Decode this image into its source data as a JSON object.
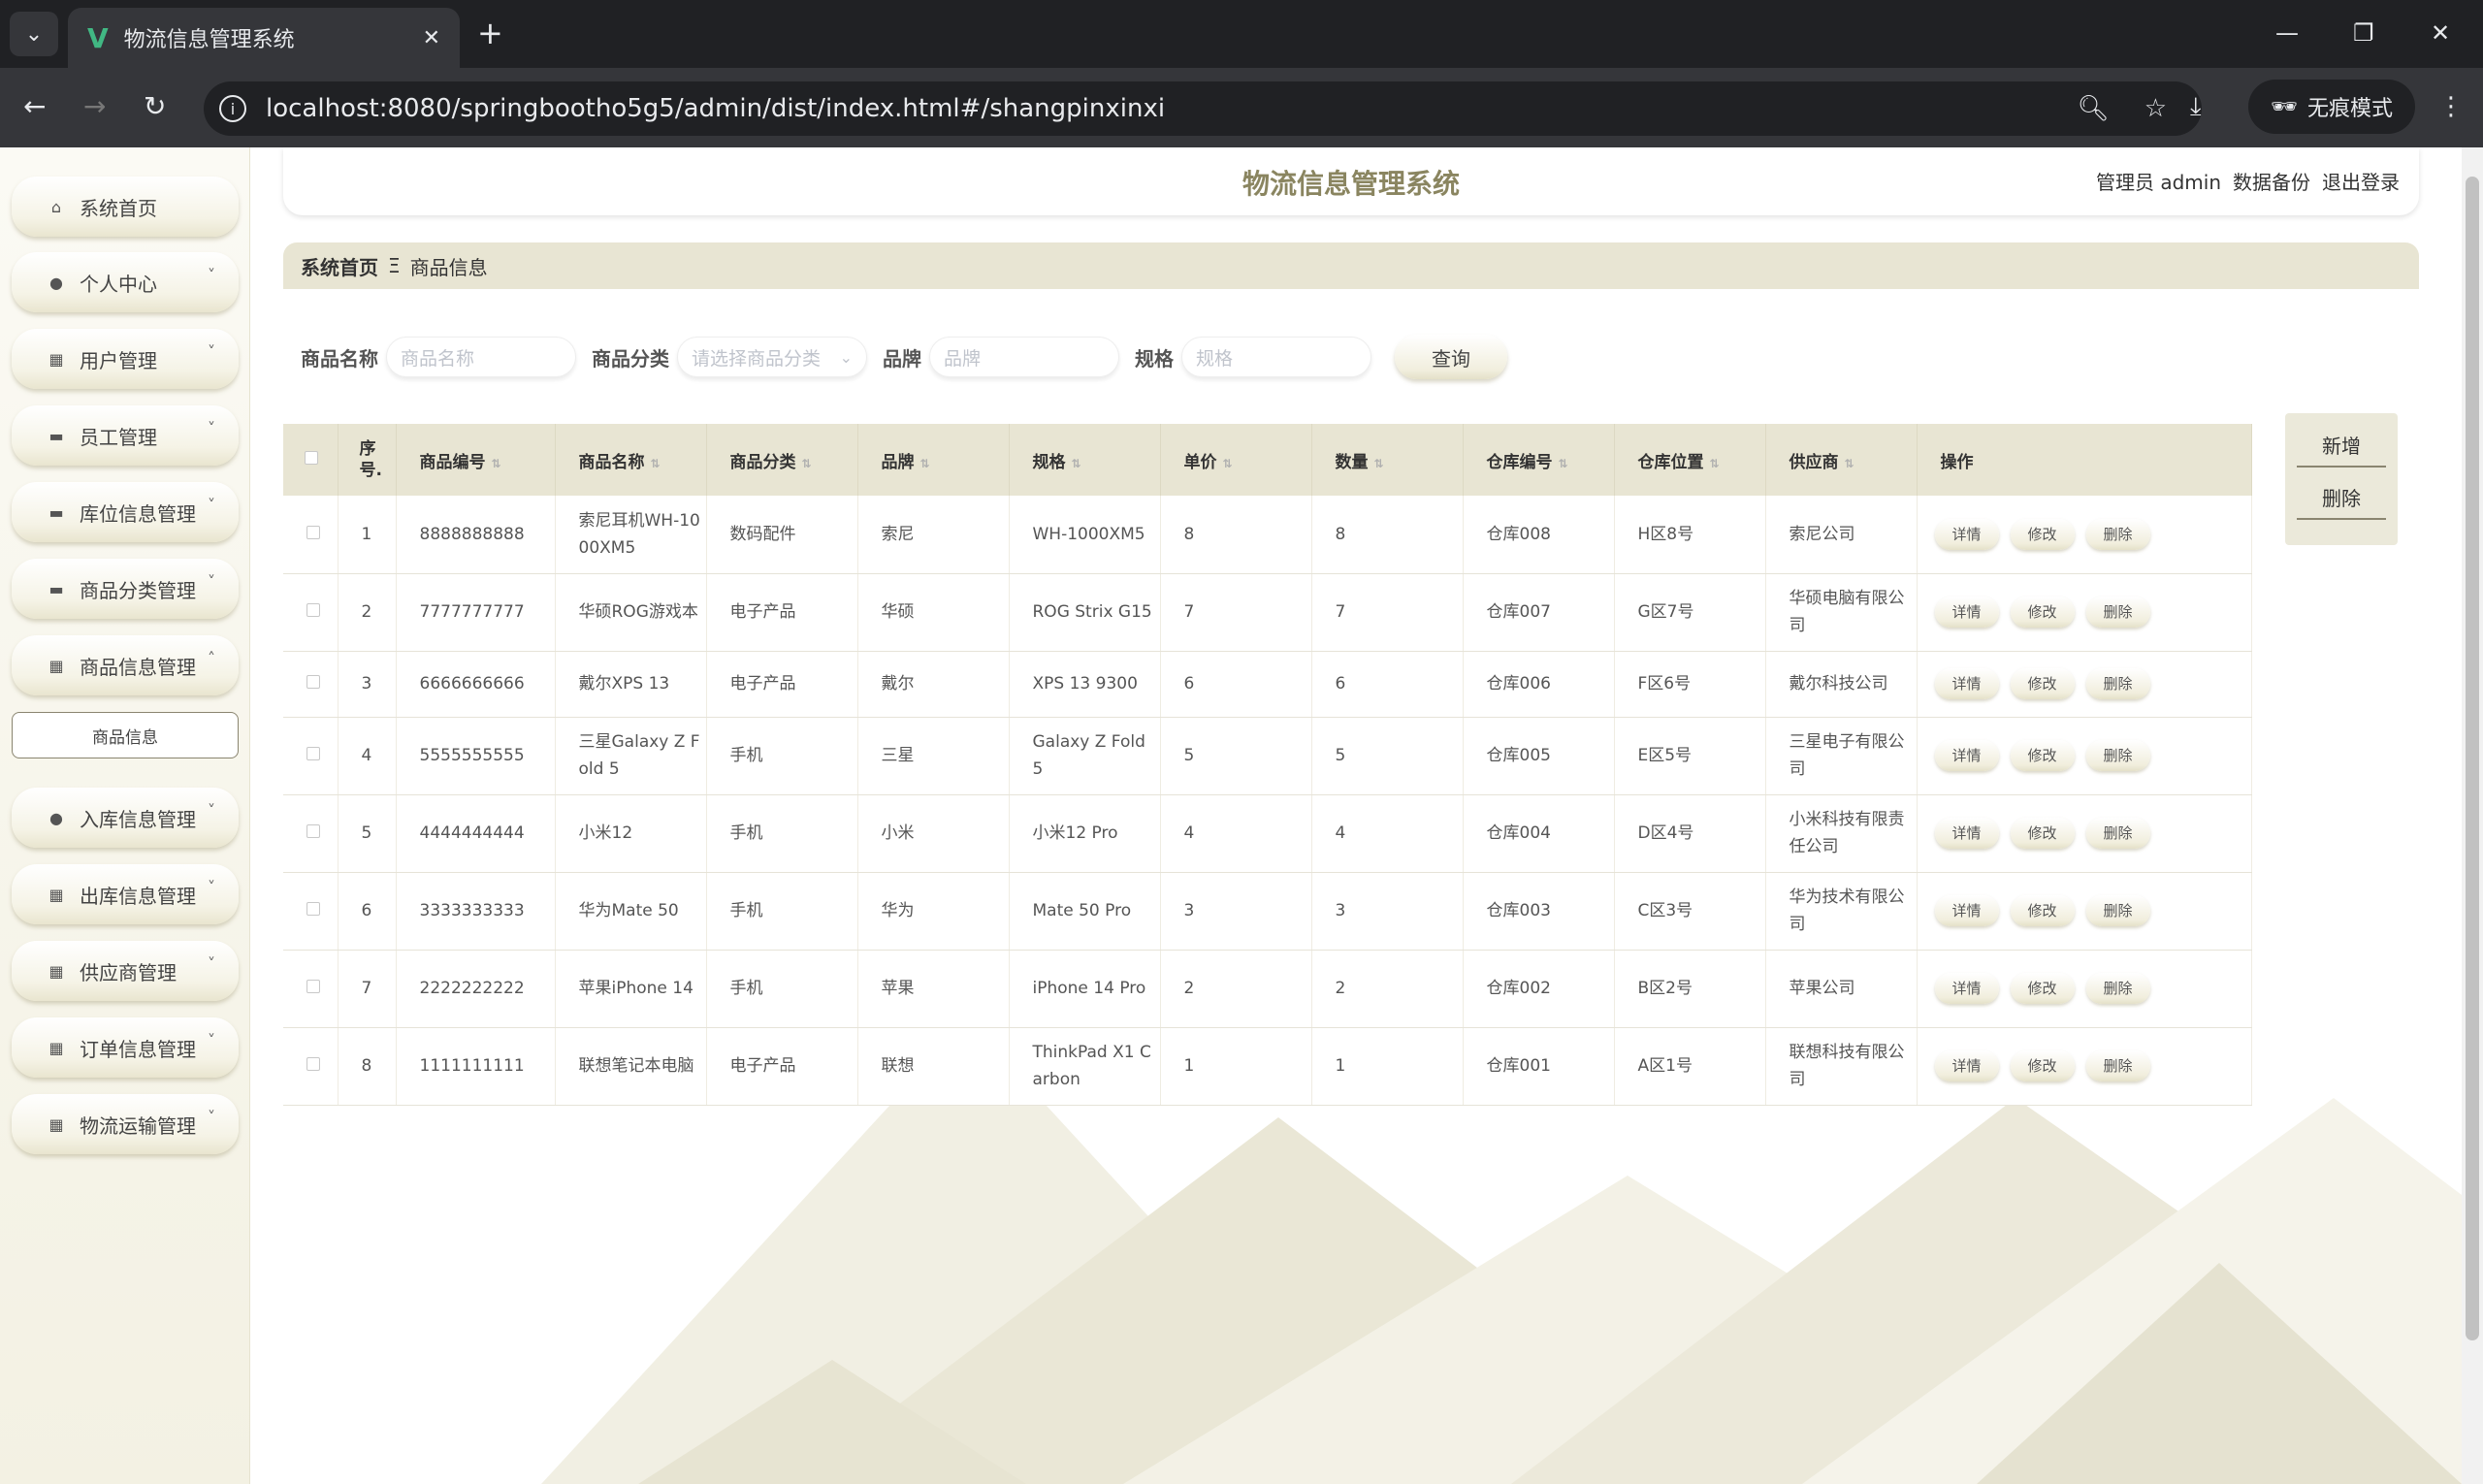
{
  "browser": {
    "tab_title": "物流信息管理系统",
    "url": "localhost:8080/springbootho5g5/admin/dist/index.html#/shangpinxinxi",
    "incognito_label": "无痕模式"
  },
  "app": {
    "title": "物流信息管理系统",
    "user_role": "管理员",
    "username": "admin",
    "backup": "数据备份",
    "logout": "退出登录"
  },
  "sidebar": {
    "items": [
      {
        "label": "系统首页",
        "icon": "home-icon"
      },
      {
        "label": "个人中心",
        "icon": "user-icon"
      },
      {
        "label": "用户管理",
        "icon": "grid-icon"
      },
      {
        "label": "员工管理",
        "icon": "chat-icon"
      },
      {
        "label": "库位信息管理",
        "icon": "briefcase-icon"
      },
      {
        "label": "商品分类管理",
        "icon": "book-icon"
      },
      {
        "label": "商品信息管理",
        "icon": "grid-icon"
      },
      {
        "label": "入库信息管理",
        "icon": "pin-icon"
      },
      {
        "label": "出库信息管理",
        "icon": "grid-icon"
      },
      {
        "label": "供应商管理",
        "icon": "grid9-icon"
      },
      {
        "label": "订单信息管理",
        "icon": "grid-icon"
      },
      {
        "label": "物流运输管理",
        "icon": "grid-icon"
      }
    ],
    "submenu_active": "商品信息"
  },
  "breadcrumb": {
    "home": "系统首页",
    "separator": "Ξ",
    "current": "商品信息"
  },
  "search": {
    "name_label": "商品名称",
    "name_placeholder": "商品名称",
    "category_label": "商品分类",
    "category_placeholder": "请选择商品分类",
    "brand_label": "品牌",
    "brand_placeholder": "品牌",
    "spec_label": "规格",
    "spec_placeholder": "规格",
    "query_button": "查询"
  },
  "actions": {
    "add": "新增",
    "delete": "删除"
  },
  "table": {
    "headers": [
      "序号.",
      "商品编号",
      "商品名称",
      "商品分类",
      "品牌",
      "规格",
      "单价",
      "数量",
      "仓库编号",
      "仓库位置",
      "供应商",
      "操作"
    ],
    "op_labels": {
      "detail": "详情",
      "edit": "修改",
      "delete": "删除"
    },
    "rows": [
      {
        "idx": "1",
        "code": "8888888888",
        "name": "索尼耳机WH-1000XM5",
        "category": "数码配件",
        "brand": "索尼",
        "spec": "WH-1000XM5",
        "price": "8",
        "qty": "8",
        "wh_code": "仓库008",
        "wh_loc": "H区8号",
        "supplier": "索尼公司"
      },
      {
        "idx": "2",
        "code": "7777777777",
        "name": "华硕ROG游戏本",
        "category": "电子产品",
        "brand": "华硕",
        "spec": "ROG Strix G15",
        "price": "7",
        "qty": "7",
        "wh_code": "仓库007",
        "wh_loc": "G区7号",
        "supplier": "华硕电脑有限公司"
      },
      {
        "idx": "3",
        "code": "6666666666",
        "name": "戴尔XPS 13",
        "category": "电子产品",
        "brand": "戴尔",
        "spec": "XPS 13 9300",
        "price": "6",
        "qty": "6",
        "wh_code": "仓库006",
        "wh_loc": "F区6号",
        "supplier": "戴尔科技公司"
      },
      {
        "idx": "4",
        "code": "5555555555",
        "name": "三星Galaxy Z Fold 5",
        "category": "手机",
        "brand": "三星",
        "spec": "Galaxy Z Fold 5",
        "price": "5",
        "qty": "5",
        "wh_code": "仓库005",
        "wh_loc": "E区5号",
        "supplier": "三星电子有限公司"
      },
      {
        "idx": "5",
        "code": "4444444444",
        "name": "小米12",
        "category": "手机",
        "brand": "小米",
        "spec": "小米12 Pro",
        "price": "4",
        "qty": "4",
        "wh_code": "仓库004",
        "wh_loc": "D区4号",
        "supplier": "小米科技有限责任公司"
      },
      {
        "idx": "6",
        "code": "3333333333",
        "name": "华为Mate 50",
        "category": "手机",
        "brand": "华为",
        "spec": "Mate 50 Pro",
        "price": "3",
        "qty": "3",
        "wh_code": "仓库003",
        "wh_loc": "C区3号",
        "supplier": "华为技术有限公司"
      },
      {
        "idx": "7",
        "code": "2222222222",
        "name": "苹果iPhone 14",
        "category": "手机",
        "brand": "苹果",
        "spec": "iPhone 14 Pro",
        "price": "2",
        "qty": "2",
        "wh_code": "仓库002",
        "wh_loc": "B区2号",
        "supplier": "苹果公司"
      },
      {
        "idx": "8",
        "code": "1111111111",
        "name": "联想笔记本电脑",
        "category": "电子产品",
        "brand": "联想",
        "spec": "ThinkPad X1 Carbon",
        "price": "1",
        "qty": "1",
        "wh_code": "仓库001",
        "wh_loc": "A区1号",
        "supplier": "联想科技有限公司"
      }
    ]
  }
}
